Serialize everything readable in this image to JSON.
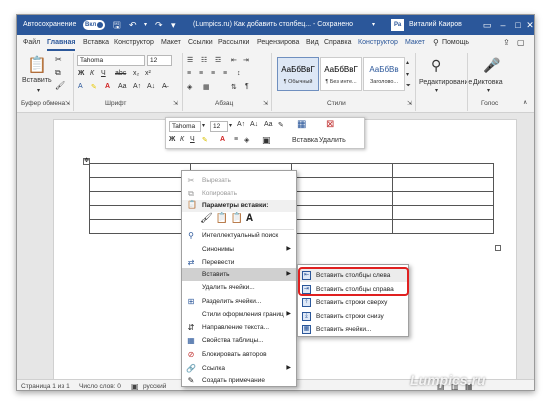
{
  "titlebar": {
    "autosave_label": "Автосохранение",
    "autosave_state": "Вкл",
    "title": "(Lumpics.ru) Как добавить столбец... - Сохранено",
    "user_badge": "Ра",
    "user_name": "Виталий Каиров",
    "accent": "#2b579a"
  },
  "ribbon_tabs": [
    "Файл",
    "Главная",
    "Вставка",
    "Конструктор",
    "Макет",
    "Ссылки",
    "Рассылки",
    "Рецензирова",
    "Вид",
    "Справка",
    "Конструктор",
    "Макет",
    "Помощь"
  ],
  "ribbon": {
    "paste_label": "Вставить",
    "font_name": "Tahoma",
    "font_size": "12",
    "styles": [
      {
        "sample": "АаБбВвГ",
        "name": "¶ Обычный"
      },
      {
        "sample": "АаБбВвГ",
        "name": "¶ Без инте..."
      },
      {
        "sample": "АаБбВв",
        "name": "Заголово..."
      }
    ],
    "editing_label": "Редактирование",
    "dictation_label": "Диктовка",
    "groups": [
      "Буфер обмена",
      "Шрифт",
      "Абзац",
      "Стили",
      "Голос"
    ]
  },
  "minitoolbar": {
    "font_name": "Tahoma",
    "font_size": "12",
    "insert_label": "Вставка",
    "delete_label": "Удалить"
  },
  "context_menu": {
    "cut": "Вырезать",
    "copy": "Копировать",
    "paste_header": "Параметры вставки:",
    "smart_lookup": "Интеллектуальный поиск",
    "synonyms": "Синонимы",
    "translate": "Перевести",
    "insert": "Вставить",
    "delete_cells": "Удалить ячейки...",
    "split_cells": "Разделить ячейки...",
    "border_styles": "Стили оформления границ",
    "text_direction": "Направление текста...",
    "table_props": "Свойства таблицы...",
    "block_authors": "Блокировать авторов",
    "link": "Ссылка",
    "new_comment": "Создать примечание"
  },
  "submenu": {
    "insert_left": "Вставить столбцы слева",
    "insert_right": "Вставить столбцы справа",
    "insert_above": "Вставить строки сверху",
    "insert_below": "Вставить строки снизу",
    "insert_cells": "Вставить ячейки..."
  },
  "statusbar": {
    "page": "Страница 1 из 1",
    "words": "Число слов: 0",
    "language": "русский"
  },
  "watermark": "Lumpics.ru"
}
